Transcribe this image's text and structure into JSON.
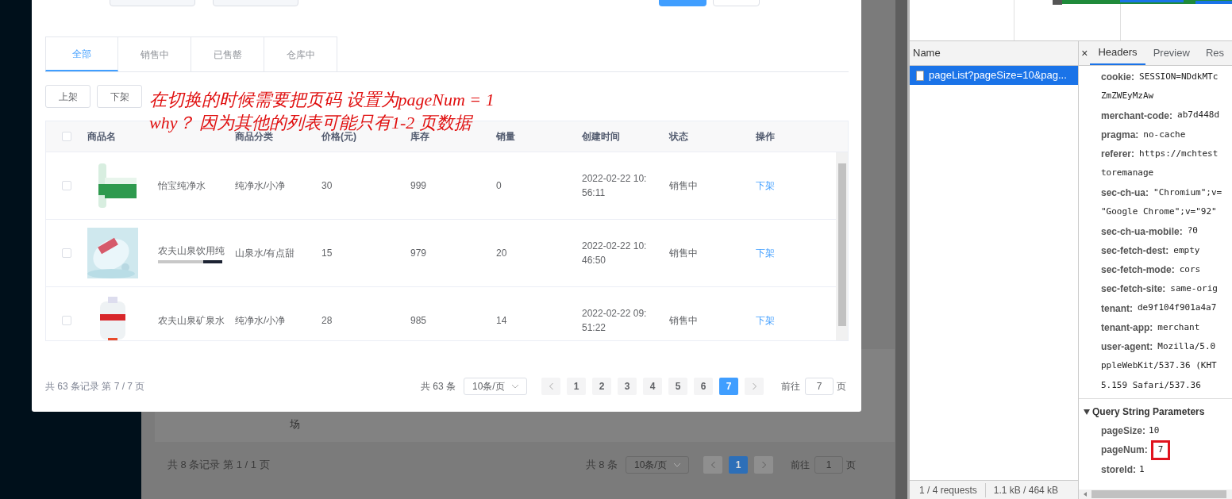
{
  "background_page": {
    "fragment": "场",
    "footer_summary": "共 8 条记录 第 1 / 1 页",
    "pagination": {
      "total": "共 8 条",
      "page_size": "10条/页",
      "pages": [
        {
          "label": "1",
          "selected": true
        }
      ],
      "goto_label": "前往",
      "goto_value": "1",
      "goto_unit": "页"
    }
  },
  "dialog": {
    "tabs": [
      {
        "label": "全部",
        "selected": true
      },
      {
        "label": "销售中",
        "selected": false
      },
      {
        "label": "已售罄",
        "selected": false
      },
      {
        "label": "仓库中",
        "selected": false
      }
    ],
    "actions": [
      "上架",
      "下架"
    ],
    "annotations": [
      "在切换的时候需要把页码 设置为pageNum = 1",
      "why？ 因为其他的列表可能只有1-2 页数据"
    ],
    "table": {
      "header_checked": false,
      "columns": [
        "商品名",
        "商品分类",
        "价格(元)",
        "库存",
        "销量",
        "创建时间",
        "状态",
        "操作"
      ],
      "rows": [
        {
          "checked": false,
          "name": "怡宝纯净水",
          "name_scrollbar": false,
          "category": "纯净水/小净",
          "price": "30",
          "stock": "999",
          "sales": "0",
          "created": "2022-02-22 10:56:11",
          "status": "销售中",
          "action": "下架"
        },
        {
          "checked": false,
          "name": "农夫山泉饮用纯",
          "name_scrollbar": true,
          "category": "山泉水/有点甜",
          "price": "15",
          "stock": "979",
          "sales": "20",
          "created": "2022-02-22 10:46:50",
          "status": "销售中",
          "action": "下架"
        },
        {
          "checked": false,
          "name": "农夫山泉矿泉水",
          "name_scrollbar": false,
          "category": "纯净水/小净",
          "price": "28",
          "stock": "985",
          "sales": "14",
          "created": "2022-02-22 09:51:22",
          "status": "销售中",
          "action": "下架"
        }
      ]
    },
    "footer_summary": "共 63 条记录 第 7 / 7 页",
    "pagination": {
      "total": "共 63 条",
      "page_size": "10条/页",
      "pages": [
        {
          "label": "1",
          "selected": false
        },
        {
          "label": "2",
          "selected": false
        },
        {
          "label": "3",
          "selected": false
        },
        {
          "label": "4",
          "selected": false
        },
        {
          "label": "5",
          "selected": false
        },
        {
          "label": "6",
          "selected": false
        },
        {
          "label": "7",
          "selected": true
        }
      ],
      "goto_label": "前往",
      "goto_value": "7",
      "goto_unit": "页"
    }
  },
  "devtools": {
    "name_column": "Name",
    "requests": [
      {
        "label": "pageList?pageSize=10&pag...",
        "selected": true
      }
    ],
    "close": "×",
    "tabs": [
      {
        "label": "Headers",
        "selected": true
      },
      {
        "label": "Preview",
        "selected": false
      },
      {
        "label": "Res",
        "selected": false
      }
    ],
    "headers": [
      {
        "kind": "header",
        "name": "cookie:",
        "value": "SESSION=NDdkMTc"
      },
      {
        "kind": "continuation",
        "value": "ZmZWEyMzAw"
      },
      {
        "kind": "header",
        "name": "merchant-code:",
        "value": "ab7d448d"
      },
      {
        "kind": "header",
        "name": "pragma:",
        "value": "no-cache"
      },
      {
        "kind": "header",
        "name": "referer:",
        "value": "https://mchtest"
      },
      {
        "kind": "continuation",
        "value": "toremanage"
      },
      {
        "kind": "header",
        "name": "sec-ch-ua:",
        "value": "\"Chromium\";v="
      },
      {
        "kind": "continuation",
        "value": "\"Google Chrome\";v=\"92\""
      },
      {
        "kind": "header",
        "name": "sec-ch-ua-mobile:",
        "value": "?0"
      },
      {
        "kind": "header",
        "name": "sec-fetch-dest:",
        "value": "empty"
      },
      {
        "kind": "header",
        "name": "sec-fetch-mode:",
        "value": "cors"
      },
      {
        "kind": "header",
        "name": "sec-fetch-site:",
        "value": "same-orig"
      },
      {
        "kind": "header",
        "name": "tenant:",
        "value": "de9f104f901a4a7"
      },
      {
        "kind": "header",
        "name": "tenant-app:",
        "value": "merchant"
      },
      {
        "kind": "header",
        "name": "user-agent:",
        "value": "Mozilla/5.0"
      },
      {
        "kind": "continuation",
        "value": "ppleWebKit/537.36 (KHT"
      },
      {
        "kind": "continuation",
        "value": "5.159 Safari/537.36"
      }
    ],
    "query_section": "Query String Parameters",
    "query_params": [
      {
        "name": "pageSize:",
        "value": "10",
        "highlighted": false
      },
      {
        "name": "pageNum:",
        "value": "7",
        "highlighted": true
      },
      {
        "name": "storeId:",
        "value": "1",
        "highlighted": false
      }
    ],
    "status": [
      "1 / 4 requests",
      "1.1 kB / 464 kB"
    ]
  }
}
